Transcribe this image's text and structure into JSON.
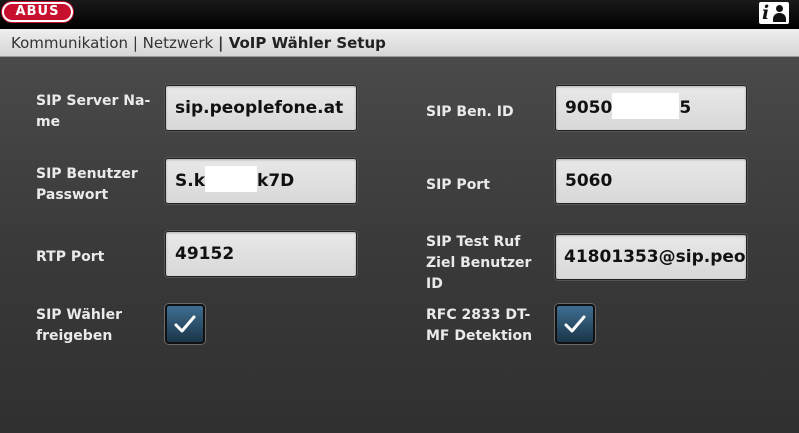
{
  "brand": {
    "logo_text": "ABUS",
    "accent": "#c8102e"
  },
  "header": {
    "info_icon": "info-user-icon"
  },
  "breadcrumb": {
    "items": [
      "Kommunikation",
      "Netzwerk",
      "VoIP Wähler Setup"
    ],
    "separator": "|"
  },
  "form": {
    "sip_server_name": {
      "label_line1": "SIP Server Na-",
      "label_line2": "me",
      "value": "sip.peoplefone.at"
    },
    "sip_password": {
      "label_line1": "SIP Benutzer",
      "label_line2": "Passwort",
      "value_prefix": "S.k",
      "value_suffix": "k7D"
    },
    "rtp_port": {
      "label": "RTP Port",
      "value": "49152"
    },
    "sip_dialer_enable": {
      "label_line1": "SIP Wähler",
      "label_line2": "freigeben",
      "checked": true
    },
    "sip_user_id": {
      "label": "SIP Ben. ID",
      "value_prefix": "9050",
      "value_suffix": "5"
    },
    "sip_port": {
      "label": "SIP Port",
      "value": "5060"
    },
    "sip_test_call": {
      "label_line1": "SIP Test Ruf",
      "label_line2": "Ziel Benutzer",
      "label_line3": "ID",
      "value": "41801353@sip.peo|"
    },
    "rfc2833": {
      "label_line1": "RFC 2833 DT-",
      "label_line2": "MF Detektion",
      "checked": true
    }
  }
}
